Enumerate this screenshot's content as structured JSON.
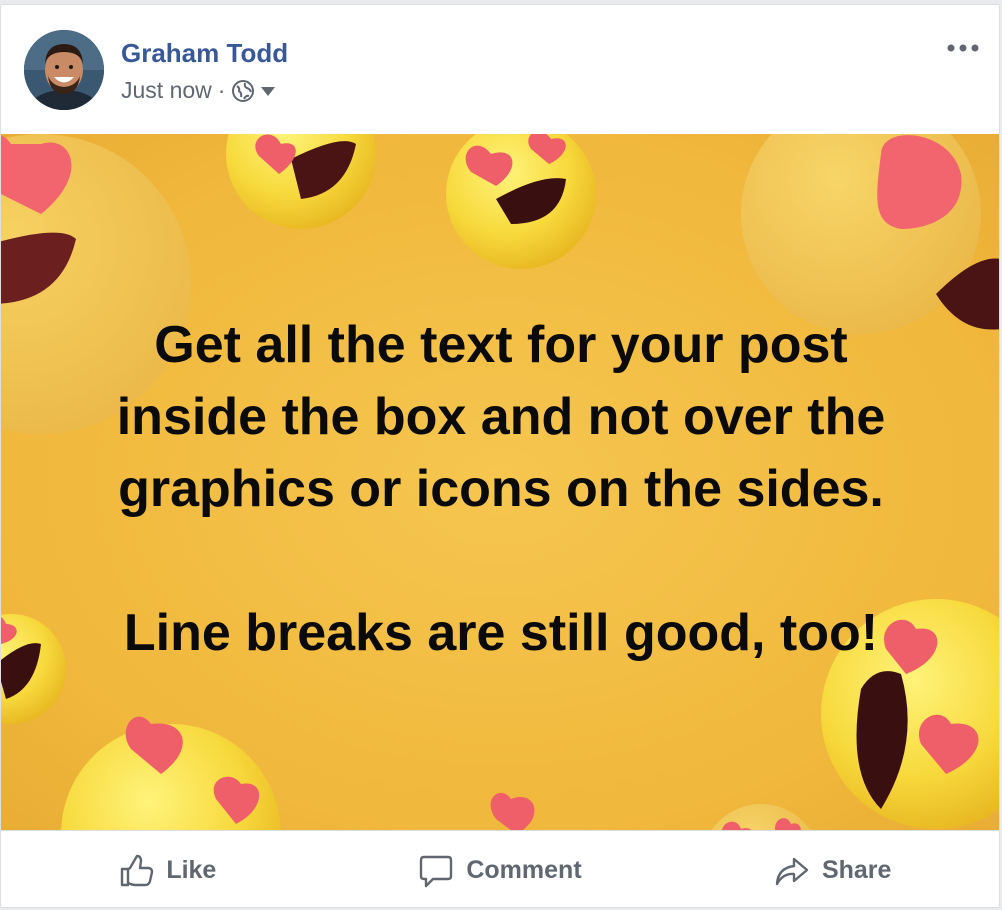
{
  "post": {
    "author_name": "Graham Todd",
    "timestamp": "Just now",
    "separator": "·",
    "privacy_icon": "globe-icon",
    "audience_caret_icon": "caret-down-icon",
    "more_options_icon": "more-dots-icon",
    "background_theme": "heart-eyes-emoji",
    "background_color": "#f2bb40",
    "text": "Get all the text for your post\ninside the box and not over the\ngraphics or icons on the sides.\n\nLine breaks are still good, too!"
  },
  "actions": {
    "like": {
      "label": "Like",
      "icon": "thumbs-up-icon"
    },
    "comment": {
      "label": "Comment",
      "icon": "comment-icon"
    },
    "share": {
      "label": "Share",
      "icon": "share-icon"
    }
  },
  "colors": {
    "author_link": "#385898",
    "meta_text": "#606770",
    "action_text": "#606770"
  }
}
